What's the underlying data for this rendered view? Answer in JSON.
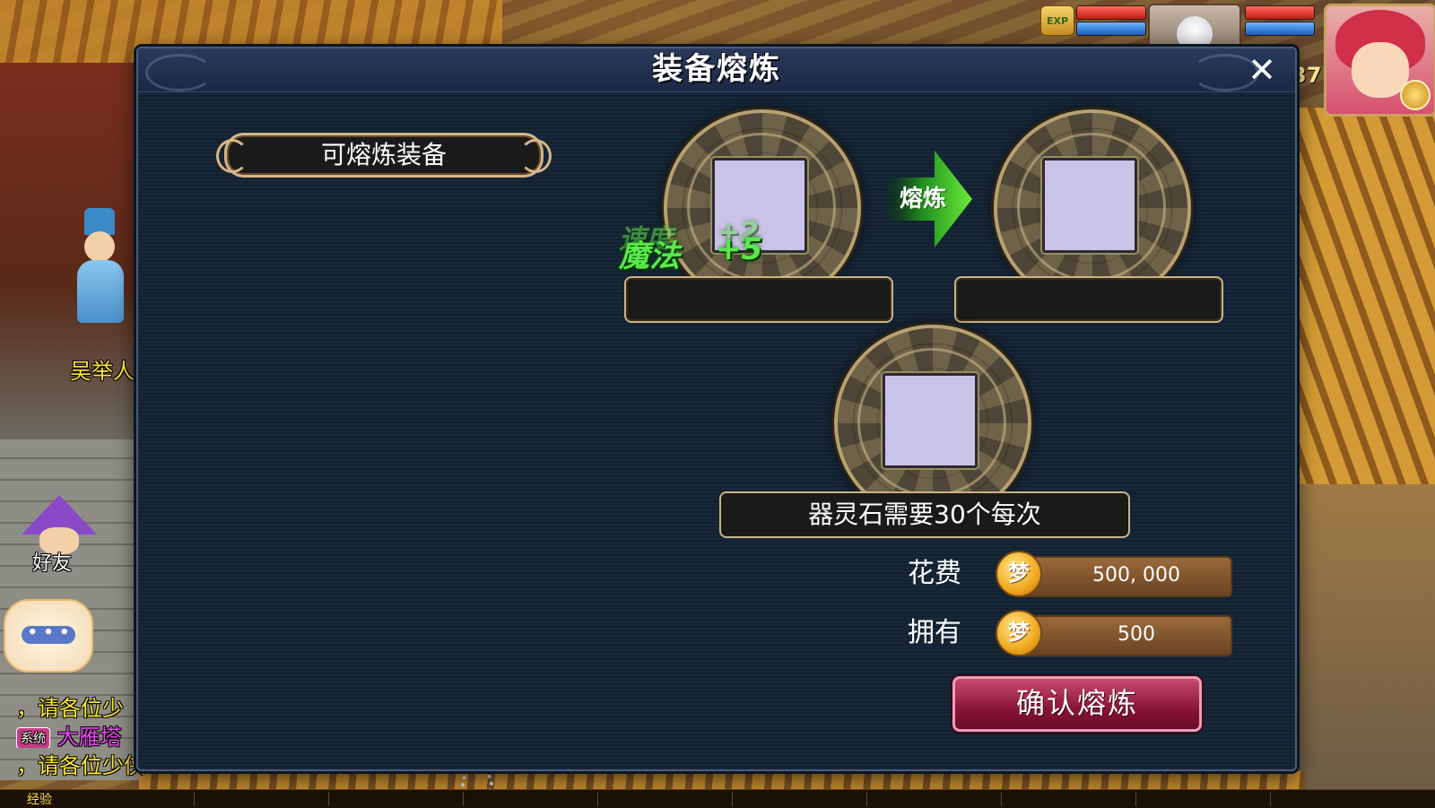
{
  "hud": {
    "exp_badge": "EXP",
    "level_fragment": "37",
    "colors": {
      "hp": "#c21e16",
      "mp": "#1e5ec2"
    }
  },
  "scene": {
    "npc_name": "吴举人",
    "friend_label": "好友",
    "chat_button_icon": "speech-bubble-icon",
    "chat_lines": [
      {
        "text": "，请各位少"
      },
      {
        "tag": "系统",
        "text": "大雁塔"
      },
      {
        "text": "，请各位少侠前去挑战。"
      }
    ],
    "exp_label": "经验"
  },
  "dialog": {
    "title": "装备熔炼",
    "close_icon": "close-icon",
    "list_header": "可熔炼装备",
    "arrow_label": "熔炼",
    "float_texts": [
      "速度",
      "魔法",
      "+2",
      "+5"
    ],
    "stone_requirement": "器灵石需要30个每次",
    "cost": {
      "label": "花费",
      "value": "500, 000"
    },
    "owned": {
      "label": "拥有",
      "value": "500"
    },
    "coin_glyph": "梦",
    "confirm_label": "确认熔炼",
    "colors": {
      "accent_green": "#5ae84a",
      "confirm": "#8a1438",
      "frame": "#c9b48a"
    }
  }
}
